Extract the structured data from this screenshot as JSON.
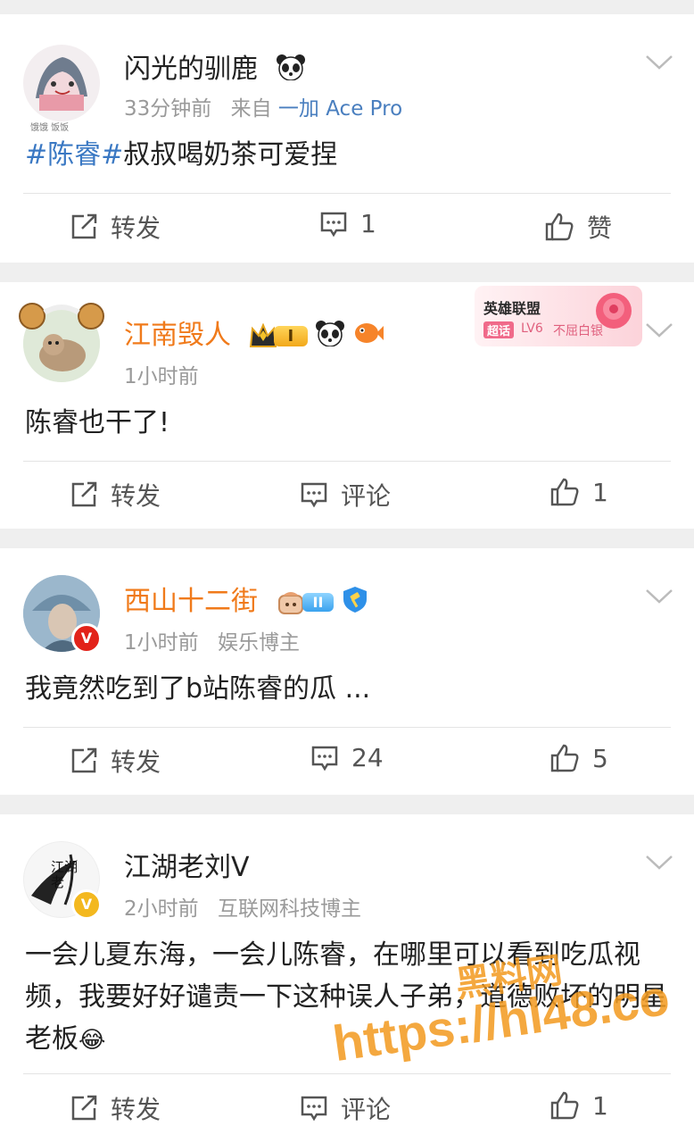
{
  "posts": [
    {
      "username": "闪光的驯鹿",
      "time": "33分钟前",
      "source_prefix": "来自",
      "source": "一加 Ace Pro",
      "topic": "#陈睿#",
      "text": "叔叔喝奶茶可爱捏",
      "repost_label": "转发",
      "comment_label": "1",
      "like_label": "赞",
      "avatar_caption": "饿饿 饭饭"
    },
    {
      "username": "江南毁人",
      "time": "1小时前",
      "text": "陈睿也干了!",
      "repost_label": "转发",
      "comment_label": "评论",
      "like_label": "1",
      "level_badge": "I",
      "super_topic": {
        "title": "英雄联盟",
        "tag": "超话",
        "level": "LV6",
        "rank": "不屈白银"
      }
    },
    {
      "username": "西山十二街",
      "time": "1小时前",
      "role": "娱乐博主",
      "text": "我竟然吃到了b站陈睿的瓜 ...",
      "repost_label": "转发",
      "comment_label": "24",
      "like_label": "5",
      "level_badge": "II",
      "verified_mark": "V"
    },
    {
      "username": "江湖老刘V",
      "time": "2小时前",
      "role": "互联网科技博主",
      "text": "一会儿夏东海，一会儿陈睿，在哪里可以看到吃瓜视频，我要好好谴责一下这种误人子弟，道德败坏的明星老板",
      "emoji": "😂",
      "repost_label": "转发",
      "comment_label": "评论",
      "like_label": "1",
      "avatar_caption": "江湖老",
      "verified_mark": "V"
    }
  ],
  "watermark": {
    "line1": "黑料网",
    "line2": "https://hl48.co"
  },
  "colors": {
    "background": "#efefef",
    "card": "#ffffff",
    "topic_blue": "#3a78c3",
    "vip_orange": "#f07a1a",
    "meta_gray": "#9a9a9a",
    "watermark_orange": "#f39a1e"
  }
}
